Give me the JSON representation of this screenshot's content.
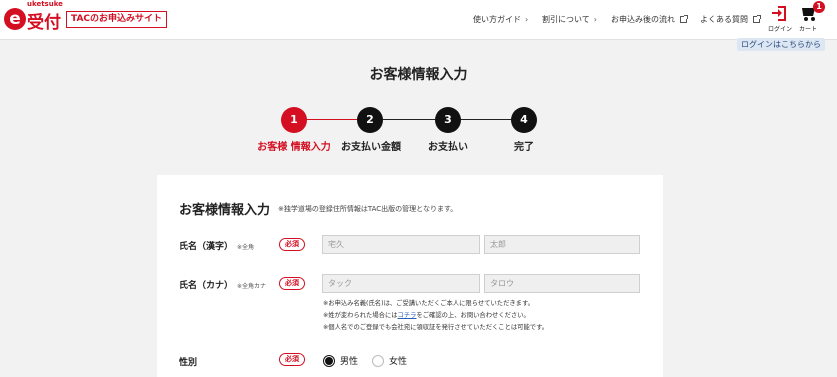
{
  "header": {
    "logo_small": "uketsuke",
    "logo_main": "受付",
    "tac_badge": "TACのお申込みサイト",
    "nav": [
      {
        "label": "使い方ガイド",
        "icon": "chevron-right-icon"
      },
      {
        "label": "割引について",
        "icon": "chevron-right-icon"
      },
      {
        "label": "お申込み後の流れ",
        "icon": "external-link-icon"
      },
      {
        "label": "よくある質問",
        "icon": "external-link-icon"
      }
    ],
    "login_label": "ログイン",
    "cart_label": "カート",
    "cart_count": "1",
    "login_link": "ログインはこちらから"
  },
  "page": {
    "title": "お客様情報入力"
  },
  "steps": [
    {
      "number": "1",
      "label": "お客様 情報入力",
      "active": true
    },
    {
      "number": "2",
      "label": "お支払い金額",
      "active": false
    },
    {
      "number": "3",
      "label": "お支払い",
      "active": false
    },
    {
      "number": "4",
      "label": "完了",
      "active": false
    }
  ],
  "form": {
    "title": "お客様情報入力",
    "title_note": "※独学道場の登録住所情報はTAC出版の管理となります。",
    "required_label": "必須",
    "name_kanji": {
      "label": "氏名（漢字）",
      "sub": "※全角",
      "last_placeholder": "宅久",
      "first_placeholder": "太郎"
    },
    "name_kana": {
      "label": "氏名（カナ）",
      "sub": "※全角カナ",
      "last_placeholder": "タック",
      "first_placeholder": "タロウ"
    },
    "notes": {
      "line1": "※お申込み名義(氏名)は、ご受講いただくご本人に限らせていただきます。",
      "line2_pre": "※姓が変わられた場合には",
      "line2_link": "コチラ",
      "line2_post": "をご確認の上、お問い合わせください。",
      "line3": "※個人名でのご登録でも会社宛に領収証を発行させていただくことは可能です。"
    },
    "gender": {
      "label": "性別",
      "options": [
        {
          "label": "男性",
          "selected": true
        },
        {
          "label": "女性",
          "selected": false
        }
      ]
    }
  },
  "colors": {
    "accent": "#d40f22",
    "background": "#f2f2f2",
    "step_inactive": "#111111"
  }
}
